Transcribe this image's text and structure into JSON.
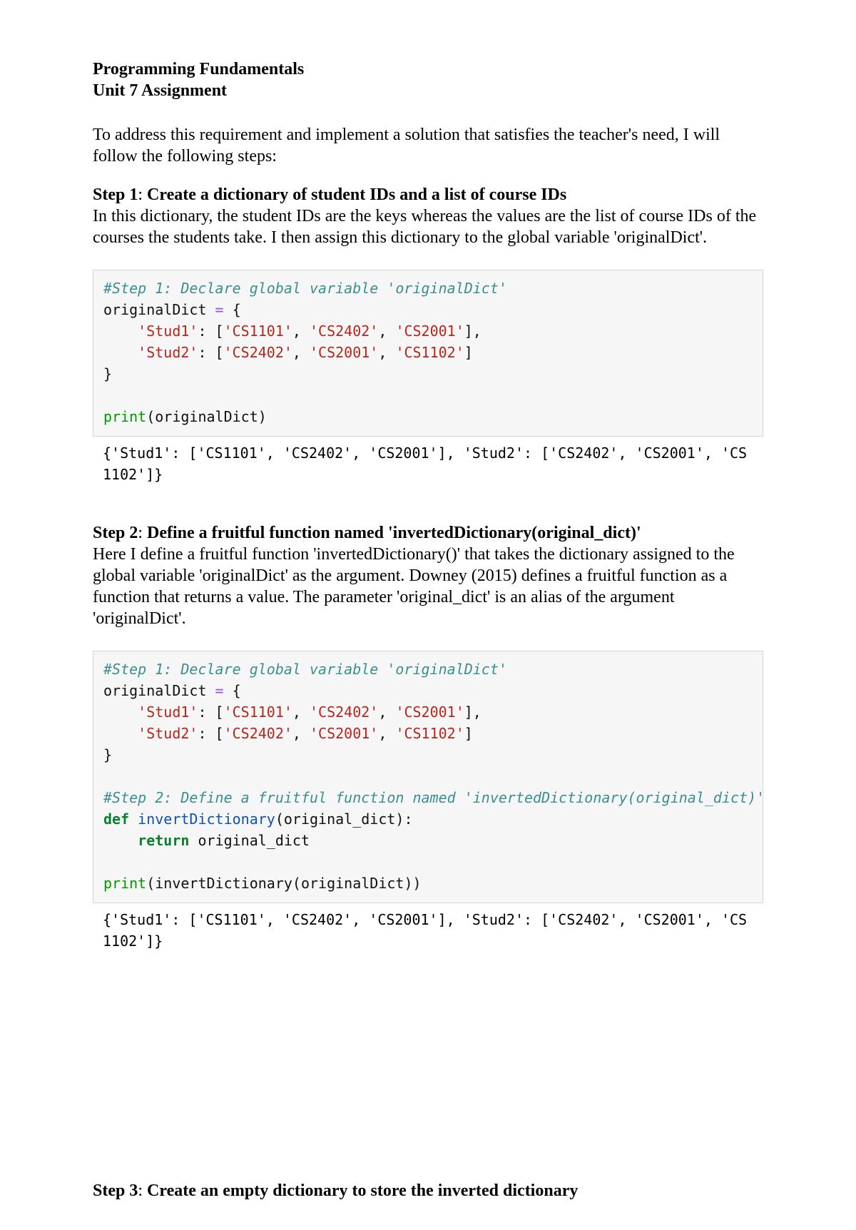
{
  "header": {
    "line1": "Programming Fundamentals",
    "line2": "Unit 7 Assignment"
  },
  "intro": "To address this requirement and implement a solution that satisfies the teacher's need, I will follow the following steps:",
  "step1": {
    "label": "Step 1",
    "title": "Create a dictionary of student IDs and a list of course IDs",
    "body": "In this dictionary, the student IDs are the keys whereas the values are the list of course IDs of the courses the students take. I then assign this dictionary to the global variable 'originalDict'."
  },
  "step2": {
    "label": "Step 2",
    "title": "Define a fruitful function named 'invertedDictionary(original_dict)'",
    "body": "Here I define a fruitful function 'invertedDictionary()' that takes the dictionary assigned to the global variable 'originalDict' as the argument. Downey (2015) defines a fruitful function as a function that returns a value. The parameter 'original_dict' is an alias of the argument 'originalDict'."
  },
  "step3": {
    "label": "Step 3",
    "title": "Create an empty dictionary to store the inverted dictionary"
  },
  "code1": {
    "comment1": "#Step 1: Declare global variable 'originalDict'",
    "assignLHS": "originalDict",
    "eq": " = ",
    "brace_open": "{",
    "line_k1": "'Stud1'",
    "line_v1a": "'CS1101'",
    "line_v1b": "'CS2402'",
    "line_v1c": "'CS2001'",
    "line_k2": "'Stud2'",
    "line_v2a": "'CS2402'",
    "line_v2b": "'CS2001'",
    "line_v2c": "'CS1102'",
    "brace_close": "}",
    "printFn": "print",
    "printArg": "(originalDict)",
    "output": "{'Stud1': ['CS1101', 'CS2402', 'CS2001'], 'Stud2': ['CS2402', 'CS2001', 'CS1102']}"
  },
  "code2": {
    "comment1": "#Step 1: Declare global variable 'originalDict'",
    "comment2": "#Step 2: Define a fruitful function named 'invertedDictionary(original_dict)'",
    "def": "def",
    "defName": " invertDictionary",
    "defArgs": "(original_dict):",
    "ret": "return",
    "retArg": " original_dict",
    "printFn": "print",
    "printArg": "(invertDictionary(originalDict))",
    "output": "{'Stud1': ['CS1101', 'CS2402', 'CS2001'], 'Stud2': ['CS2402', 'CS2001', 'CS1102']}"
  }
}
